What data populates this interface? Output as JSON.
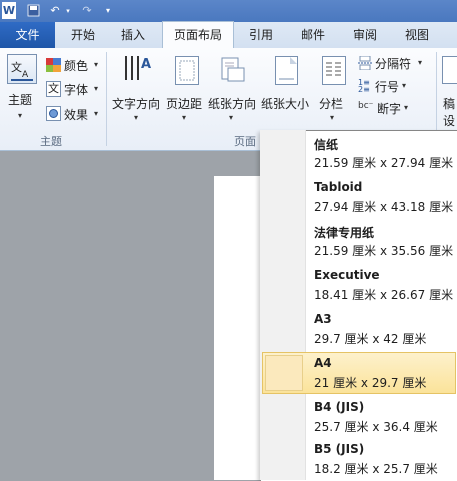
{
  "titlebar": {
    "app_icon": "W"
  },
  "tabs": [
    "文件",
    "开始",
    "插入",
    "页面布局",
    "引用",
    "邮件",
    "审阅",
    "视图"
  ],
  "ribbon": {
    "theme_label": "主题",
    "colors_label": "颜色",
    "fonts_label": "字体",
    "effects_label": "效果",
    "themes_group": "主题",
    "text_direction": "文字方向",
    "margins": "页边距",
    "orientation": "纸张方向",
    "size": "纸张大小",
    "columns": "分栏",
    "page_group": "页面",
    "breaks": "分隔符",
    "line_numbers": "行号",
    "hyphenation": "断字",
    "watermark_partial": "稿",
    "watermark_partial2": "设"
  },
  "paper_sizes": [
    {
      "name": "信纸",
      "size": "21.59 厘米 x 27.94 厘米"
    },
    {
      "name": "Tabloid",
      "size": "27.94 厘米 x 43.18 厘米"
    },
    {
      "name": "法律专用纸",
      "size": "21.59 厘米 x 35.56 厘米"
    },
    {
      "name": "Executive",
      "size": "18.41 厘米 x 26.67 厘米"
    },
    {
      "name": "A3",
      "size": "29.7 厘米 x 42 厘米"
    },
    {
      "name": "A4",
      "size": "21 厘米 x 29.7 厘米"
    },
    {
      "name": "B4 (JIS)",
      "size": "25.7 厘米 x 36.4 厘米"
    },
    {
      "name": "B5 (JIS)",
      "size": "18.2 厘米 x 25.7 厘米"
    }
  ],
  "selected_paper": "A4"
}
